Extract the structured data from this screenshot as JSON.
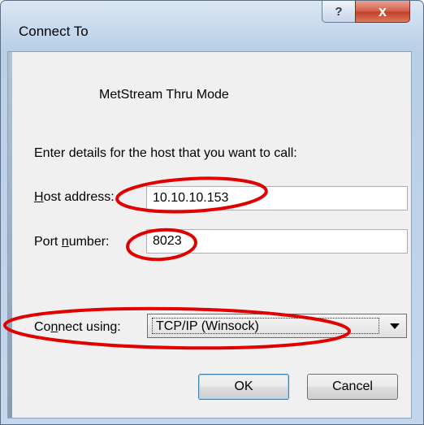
{
  "window": {
    "title": "Connect To"
  },
  "titlebar": {
    "help_glyph": "?",
    "close_glyph": "x",
    "help_icon": "help-icon",
    "close_icon": "close-icon"
  },
  "dialog": {
    "heading": "MetStream Thru Mode",
    "prompt": "Enter details for the host that you want to call:",
    "host_label_hotkey": "H",
    "host_label_rest": "ost address:",
    "host_value": "10.10.10.153",
    "port_label_start": "Port ",
    "port_label_hotkey": "n",
    "port_label_end": "umber:",
    "port_value": "8023",
    "connect_label_start": "Co",
    "connect_label_hotkey": "n",
    "connect_label_end": "nect using:",
    "connect_value": "TCP/IP (Winsock)",
    "ok_label": "OK",
    "cancel_label": "Cancel"
  },
  "annotations": {
    "color": "#e00000"
  }
}
